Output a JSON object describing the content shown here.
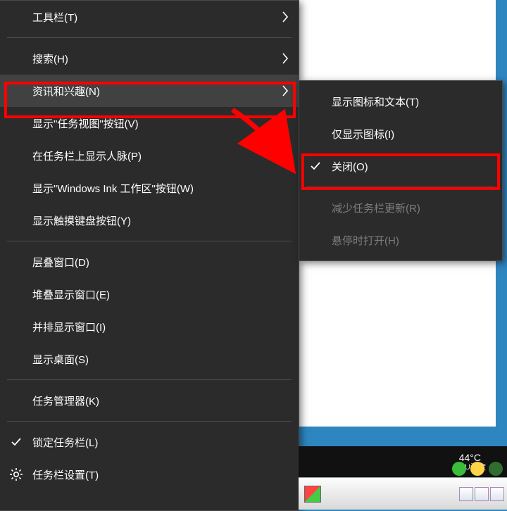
{
  "main_menu": {
    "toolbars": "工具栏(T)",
    "search": "搜索(H)",
    "news": "资讯和兴趣(N)",
    "taskview": "显示\"任务视图\"按钮(V)",
    "people": "在任务栏上显示人脉(P)",
    "ink": "显示\"Windows Ink 工作区\"按钮(W)",
    "touchkb": "显示触摸键盘按钮(Y)",
    "cascade": "层叠窗口(D)",
    "stacked": "堆叠显示窗口(E)",
    "sidebyside": "并排显示窗口(I)",
    "showdesk": "显示桌面(S)",
    "taskmgr": "任务管理器(K)",
    "lock": "锁定任务栏(L)",
    "settings": "任务栏设置(T)"
  },
  "sub_menu": {
    "icon_text": "显示图标和文本(T)",
    "icon_only": "仅显示图标(I)",
    "off": "关闭(O)",
    "reduce": "减少任务栏更新(R)",
    "hover_open": "悬停时打开(H)"
  },
  "status": {
    "temperature": "44°C",
    "label": "CPU温度"
  }
}
